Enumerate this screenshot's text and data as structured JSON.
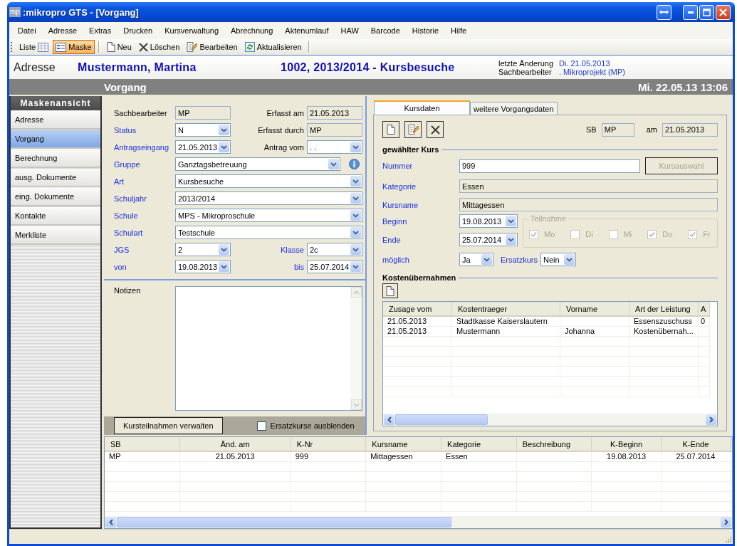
{
  "window": {
    "icon_text": "mp",
    "title": ":mikropro GTS - [Vorgang]"
  },
  "menu": [
    "Datei",
    "Adresse",
    "Extras",
    "Drucken",
    "Kursverwaltung",
    "Abrechnung",
    "Aktenumlauf",
    "HAW",
    "Barcode",
    "Historie",
    "Hilfe"
  ],
  "toolbar": {
    "views": [
      {
        "kind": "list",
        "label": "Liste",
        "selected": false
      },
      {
        "kind": "form",
        "label": "Maske",
        "selected": true
      }
    ],
    "actions": [
      {
        "kind": "new",
        "label": "Neu"
      },
      {
        "kind": "delete",
        "label": "Löschen"
      },
      {
        "kind": "edit",
        "label": "Bearbeiten"
      },
      {
        "kind": "refresh",
        "label": "Aktualisieren"
      }
    ]
  },
  "header": {
    "section": "Adresse",
    "name": "Mustermann, Martina",
    "case": "1002, 2013/2014 - Kursbesuche",
    "meta": [
      {
        "label": "letzte Änderung",
        "value": "Di. 21.05.2013"
      },
      {
        "label": "Sachbearbeiter",
        "value": ". Mikroprojekt (MP)"
      }
    ]
  },
  "caption": {
    "title": "Vorgang",
    "datetime": "Mi. 22.05.13 13:06"
  },
  "sidebar": {
    "title": "Maskenansicht",
    "items": [
      {
        "label": "Adresse",
        "selected": false
      },
      {
        "label": "Vorgang",
        "selected": true
      },
      {
        "label": "Berechnung",
        "selected": false
      },
      {
        "label": "ausg. Dokumente",
        "selected": false
      },
      {
        "label": "eing. Dokumente",
        "selected": false
      },
      {
        "label": "Kontakte",
        "selected": false
      },
      {
        "label": "Merkliste",
        "selected": false
      }
    ]
  },
  "form": {
    "rows": [
      {
        "fields": [
          {
            "label": "Sachbearbeiter",
            "required": false,
            "kind": "readonly",
            "value": "MP"
          },
          {
            "label": "Erfasst am",
            "required": false,
            "kind": "readonly",
            "value": "21.05.2013"
          }
        ]
      },
      {
        "fields": [
          {
            "label": "Status",
            "required": true,
            "kind": "combo",
            "value": "N"
          },
          {
            "label": "Erfasst durch",
            "required": false,
            "kind": "readonly",
            "value": "MP"
          }
        ]
      },
      {
        "fields": [
          {
            "label": "Antragseingang",
            "required": true,
            "kind": "combo",
            "value": "21.05.2013"
          },
          {
            "label": "Antrag vom",
            "required": false,
            "kind": "combo",
            "value": ". ."
          }
        ]
      },
      {
        "fields": [
          {
            "label": "Gruppe",
            "required": true,
            "kind": "combo",
            "value": "Ganztagsbetreuung",
            "info": true
          }
        ]
      },
      {
        "fields": [
          {
            "label": "Art",
            "required": true,
            "kind": "combo",
            "value": "Kursbesuche"
          }
        ]
      },
      {
        "fields": [
          {
            "label": "Schuljahr",
            "required": true,
            "kind": "combo",
            "value": "2013/2014"
          }
        ]
      },
      {
        "fields": [
          {
            "label": "Schule",
            "required": true,
            "kind": "combo",
            "value": "MPS - Mikroproschule"
          }
        ]
      },
      {
        "fields": [
          {
            "label": "Schulart",
            "required": true,
            "kind": "combo",
            "value": "Testschule"
          }
        ]
      },
      {
        "fields": [
          {
            "label": "JGS",
            "required": true,
            "kind": "combo",
            "value": "2"
          },
          {
            "label": "Klasse",
            "required": true,
            "kind": "combo",
            "value": "2c"
          }
        ]
      },
      {
        "fields": [
          {
            "label": "von",
            "required": true,
            "kind": "combo",
            "value": "19.08.2013"
          },
          {
            "label": "bis",
            "required": true,
            "kind": "combo",
            "value": "25.07.2014"
          }
        ]
      }
    ]
  },
  "notes": {
    "label": "Notizen"
  },
  "actions": {
    "button": "Kursteilnahmen verwalten",
    "checkbox": {
      "label": "Ersatzkurse ausblenden",
      "checked": false
    }
  },
  "course": {
    "tabs": [
      {
        "label": "Kursdaten",
        "selected": true
      },
      {
        "label": "weitere Vorgangsdaten",
        "selected": false
      }
    ],
    "sb": {
      "label": "SB",
      "value": "MP"
    },
    "am": {
      "label": "am",
      "value": "21.05.2013"
    },
    "section_title": "gewählter Kurs",
    "number": {
      "label": "Nummer",
      "value": "999"
    },
    "select_button": {
      "label": "Kursauswahl",
      "disabled": true
    },
    "category": {
      "label": "Kategorie",
      "value": "Essen"
    },
    "name": {
      "label": "Kursname",
      "value": "Mittagessen"
    },
    "begin": {
      "label": "Beginn",
      "value": "19.08.2013"
    },
    "end": {
      "label": "Ende",
      "value": "25.07.2014"
    },
    "attendance": {
      "title": "Teilnahme",
      "disabled": true,
      "days": [
        {
          "label": "Mo",
          "checked": true
        },
        {
          "label": "Di",
          "checked": false
        },
        {
          "label": "Mi",
          "checked": false
        },
        {
          "label": "Do",
          "checked": true
        },
        {
          "label": "Fr",
          "checked": true
        }
      ]
    },
    "possible": {
      "label": "möglich",
      "value": "Ja"
    },
    "substitute": {
      "label": "Ersatzkurs",
      "value": "Nein"
    }
  },
  "costs": {
    "title": "Kostenübernahmen",
    "columns": [
      "Zusage vom",
      "Kostentraeger",
      "Vorname",
      "Art der Leistung",
      "A"
    ],
    "rows": [
      [
        "21.05.2013",
        "Stadtkasse Kaiserslautern",
        null,
        "Essenszuschuss",
        "0"
      ],
      [
        "21.05.2013",
        "Mustermann",
        "Johanna",
        "Kostenübernah...",
        null
      ]
    ]
  },
  "grid": {
    "columns": [
      "SB",
      "Änd. am",
      "K-Nr",
      "Kursname",
      "Kategorie",
      "Beschreibung",
      "K-Beginn",
      "K-Ende"
    ],
    "rows": [
      [
        "MP",
        "21.05.2013",
        "999",
        "Mittagessen",
        "Essen",
        null,
        "19.08.2013",
        "25.07.2014"
      ]
    ]
  }
}
